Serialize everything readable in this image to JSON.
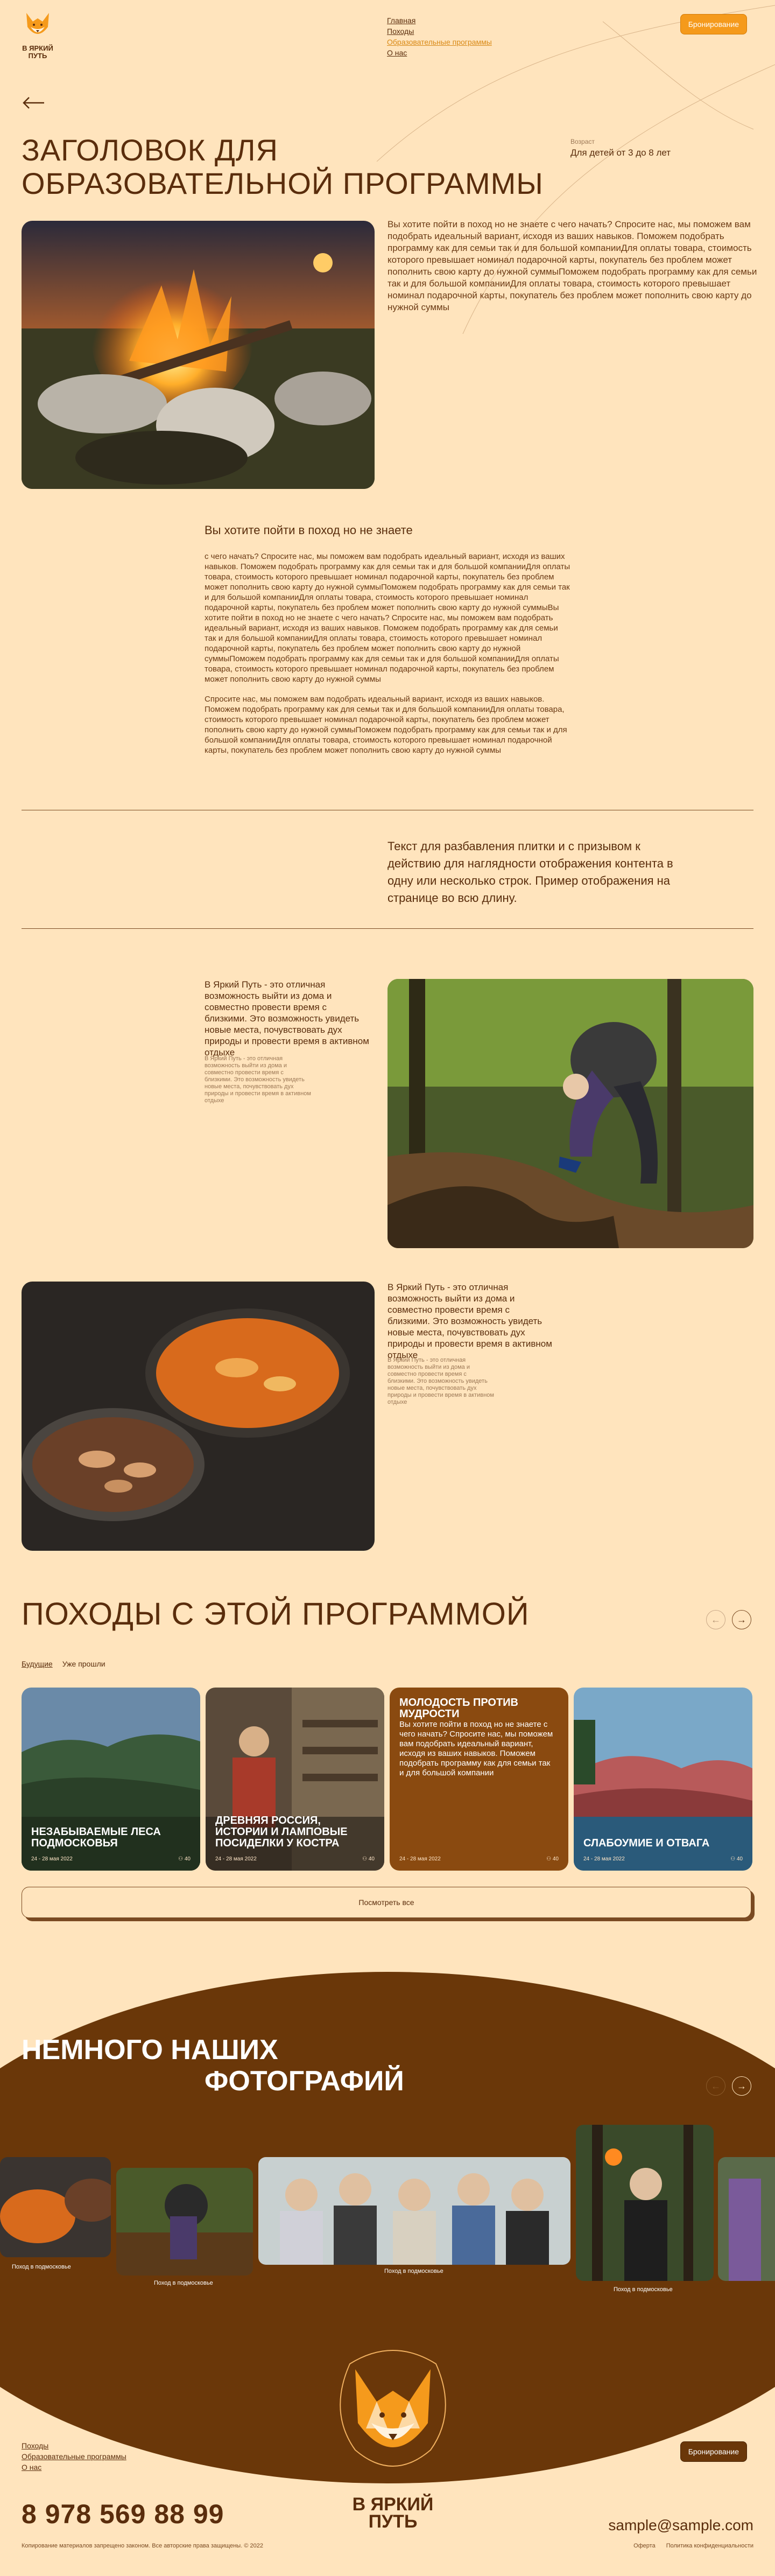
{
  "header": {
    "logo_line1": "В ЯРКИЙ",
    "logo_line2": "ПУТЬ",
    "nav": [
      "Главная",
      "Походы",
      "Образовательные программы",
      "О нас"
    ],
    "book_label": "Бронирование"
  },
  "hero": {
    "title": "ЗАГОЛОВОК ДЛЯ ОБРАЗОВАТЕЛЬНОЙ ПРОГРАММЫ",
    "age_label": "Возраст",
    "age_value": "Для детей от 3 до 8 лет",
    "text": "Вы хотите пойти в поход но не знаете с чего начать? Спросите нас, мы поможем вам подобрать идеальный вариант, исходя из ваших навыков. Поможем подобрать программу как для семьи так и для большой компанииДля оплаты товара, стоимость которого превышает номинал подарочной карты, покупатель без проблем может пополнить свою карту до нужной суммыПоможем подобрать программу как для семьи так и для большой компанииДля оплаты товара, стоимость которого превышает номинал подарочной карты, покупатель без проблем может пополнить свою карту до нужной суммы"
  },
  "section2": {
    "title": "Вы хотите пойти в поход но не знаете",
    "p1": "с чего начать? Спросите нас, мы поможем вам подобрать идеальный вариант, исходя из ваших навыков. Поможем подобрать программу как для семьи так и для большой компанииДля оплаты товара, стоимость которого превышает номинал подарочной карты, покупатель без проблем может пополнить свою карту до нужной суммыПоможем подобрать программу как для семьи так и для большой компанииДля оплаты товара, стоимость которого превышает номинал подарочной карты, покупатель без проблем может пополнить свою карту до нужной суммыВы хотите пойти в поход но не знаете с чего начать? Спросите нас, мы поможем вам подобрать идеальный вариант, исходя из ваших навыков. Поможем подобрать программу как для семьи так и для большой компанииДля оплаты товара, стоимость которого превышает номинал подарочной карты, покупатель без проблем может пополнить свою карту до нужной суммыПоможем подобрать программу как для семьи так и для большой компанииДля оплаты товара, стоимость которого превышает номинал подарочной карты, покупатель без проблем может пополнить свою карту до нужной суммы",
    "p2": "Спросите нас, мы поможем вам подобрать идеальный вариант, исходя из ваших навыков. Поможем подобрать программу как для семьи так и для большой компанииДля оплаты товара, стоимость которого превышает номинал подарочной карты, покупатель без проблем может пополнить свою карту до нужной суммыПоможем подобрать программу как для семьи так и для большой компанииДля оплаты товара, стоимость которого превышает номинал подарочной карты, покупатель без проблем может пополнить свою карту до нужной суммы"
  },
  "cta": {
    "text": "Текст для разбавления плитки и с призывом к действию для наглядности отображения контента в одну или несколько строк. Пример отображения на странице во всю длину."
  },
  "blocks": {
    "b1_text": "В Яркий Путь - это отличная возможность выйти из дома и совместно провести время с близкими. Это возможность увидеть новые места, почувствовать дух природы и провести время в активном отдыхе",
    "b1_small": "В Яркий Путь - это отличная возможность выйти из дома и совместно провести время с близкими. Это возможность увидеть новые места, почувствовать дух природы и провести время в активном отдыхе",
    "b2_text": "В Яркий Путь - это отличная возможность выйти из дома и совместно провести время с близкими. Это возможность увидеть новые места, почувствовать дух природы и провести время в активном отдыхе",
    "b2_small": "В Яркий Путь - это отличная возможность выйти из дома и совместно провести время с близкими. Это возможность увидеть новые места, почувствовать дух природы и провести время в активном отдыхе"
  },
  "hikes": {
    "title": "ПОХОДЫ С ЭТОЙ ПРОГРАММОЙ",
    "tabs": [
      "Будущие",
      "Уже прошли"
    ],
    "cards": [
      {
        "title": "НЕЗАБЫВАЕМЫЕ ЛЕСА ПОДМОСКОВЬЯ",
        "date": "24 - 28 мая 2022",
        "count": "40"
      },
      {
        "title": "ДРЕВНЯЯ РОССИЯ, ИСТОРИИ И ЛАМПОВЫЕ ПОСИДЕЛКИ У КОСТРА",
        "date": "24 - 28 мая 2022",
        "count": "40"
      },
      {
        "title": "МОЛОДОСТЬ ПРОТИВ МУДРОСТИ",
        "desc": "Вы хотите пойти в поход но не знаете с чего начать? Спросите нас, мы поможем вам подобрать идеальный вариант, исходя из ваших навыков. Поможем подобрать программу как для семьи так и для большой компании",
        "date": "24 - 28 мая 2022",
        "count": "40"
      },
      {
        "title": "СЛАБОУМИЕ И ОТВАГА",
        "date": "24 - 28 мая 2022",
        "count": "40"
      }
    ],
    "show_all": "Посмотреть все"
  },
  "gallery": {
    "title_line1": "НЕМНОГО НАШИХ",
    "title_line2": "ФОТОГРАФИЙ",
    "captions": [
      "Поход в подмосковье",
      "Поход в подмосковье",
      "Поход в подмосковье",
      "Поход в подмосковье"
    ]
  },
  "footer": {
    "nav": [
      "Походы",
      "Образовательные программы",
      "О нас"
    ],
    "book_label": "Бронирование",
    "logo_line1": "В ЯРКИЙ",
    "logo_line2": "ПУТЬ",
    "phone": "8 978 569 88 99",
    "email": "sample@sample.com",
    "copyright": "Копирование материалов запрещено законом. Все авторские права защищены. © 2022",
    "legal": [
      "Оферта",
      "Политика конфиденциальности"
    ]
  },
  "colors": {
    "background": "#ffe4bd",
    "primary_brown": "#5a2d0c",
    "accent_orange": "#f59a1c",
    "band_brown": "#6a3709"
  }
}
